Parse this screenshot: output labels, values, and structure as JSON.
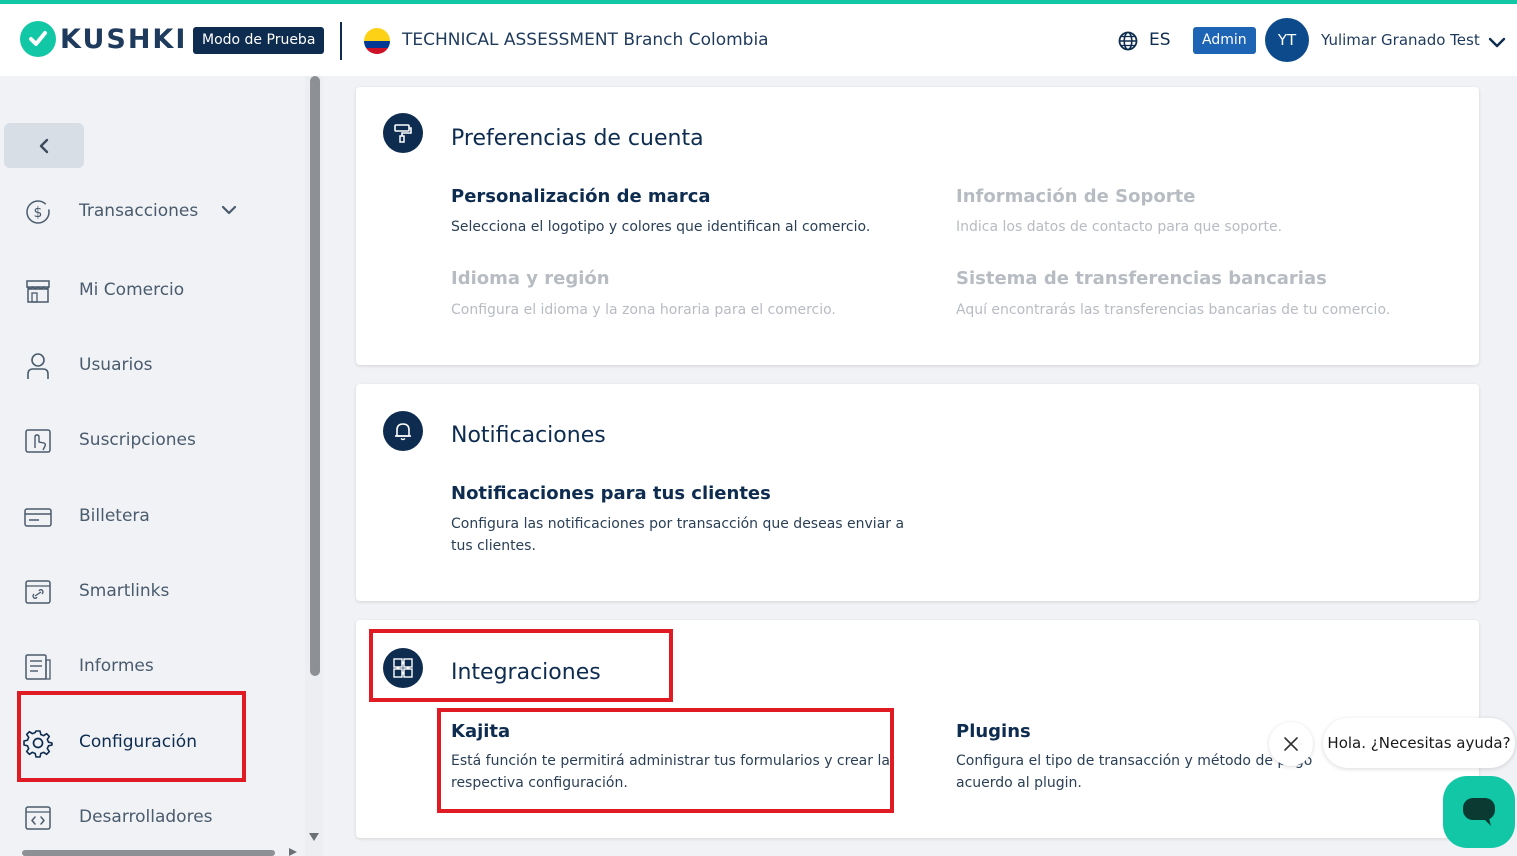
{
  "header": {
    "logo_text": "KUSHKI",
    "test_mode_label": "Modo de Prueba",
    "branch_name": "TECHNICAL ASSESSMENT Branch Colombia",
    "language": "ES",
    "role_badge": "Admin",
    "avatar_initials": "YT",
    "user_name": "Yulimar Granado Test"
  },
  "sidebar": {
    "items": [
      {
        "label": "Transacciones",
        "icon": "dollar-circle-icon"
      },
      {
        "label": "Mi Comercio",
        "icon": "store-icon"
      },
      {
        "label": "Usuarios",
        "icon": "user-icon"
      },
      {
        "label": "Suscripciones",
        "icon": "hand-tap-icon"
      },
      {
        "label": "Billetera",
        "icon": "card-icon"
      },
      {
        "label": "Smartlinks",
        "icon": "link-icon"
      },
      {
        "label": "Informes",
        "icon": "report-icon"
      },
      {
        "label": "Configuración",
        "icon": "gear-icon"
      },
      {
        "label": "Desarrolladores",
        "icon": "code-icon"
      }
    ]
  },
  "sections": {
    "account": {
      "title": "Preferencias de cuenta",
      "options": [
        {
          "title": "Personalización de marca",
          "desc": "Selecciona el logotipo y colores que identifican al comercio."
        },
        {
          "title": "Información de Soporte",
          "desc": "Indica los datos de contacto para que soporte."
        },
        {
          "title": "Idioma y región",
          "desc": "Configura el idioma y la zona horaria para el comercio."
        },
        {
          "title": "Sistema de transferencias bancarias",
          "desc": "Aquí encontrarás las transferencias bancarias de tu comercio."
        }
      ]
    },
    "notifications": {
      "title": "Notificaciones",
      "options": [
        {
          "title": "Notificaciones para tus clientes",
          "desc": "Configura las notificaciones por transacción que deseas enviar a tus clientes."
        }
      ]
    },
    "integrations": {
      "title": "Integraciones",
      "options": [
        {
          "title": "Kajita",
          "desc": "Está función te permitirá administrar tus formularios y crear la respectiva configuración."
        },
        {
          "title": "Plugins",
          "desc": "Configura el tipo de transacción y método de pago acuerdo al plugin."
        }
      ]
    }
  },
  "chat": {
    "greeting": "Hola. ¿Necesitas ayuda?"
  },
  "colors": {
    "brand_teal": "#11c7a6",
    "navy": "#0d2c4f",
    "highlight_red": "#e01b24"
  }
}
